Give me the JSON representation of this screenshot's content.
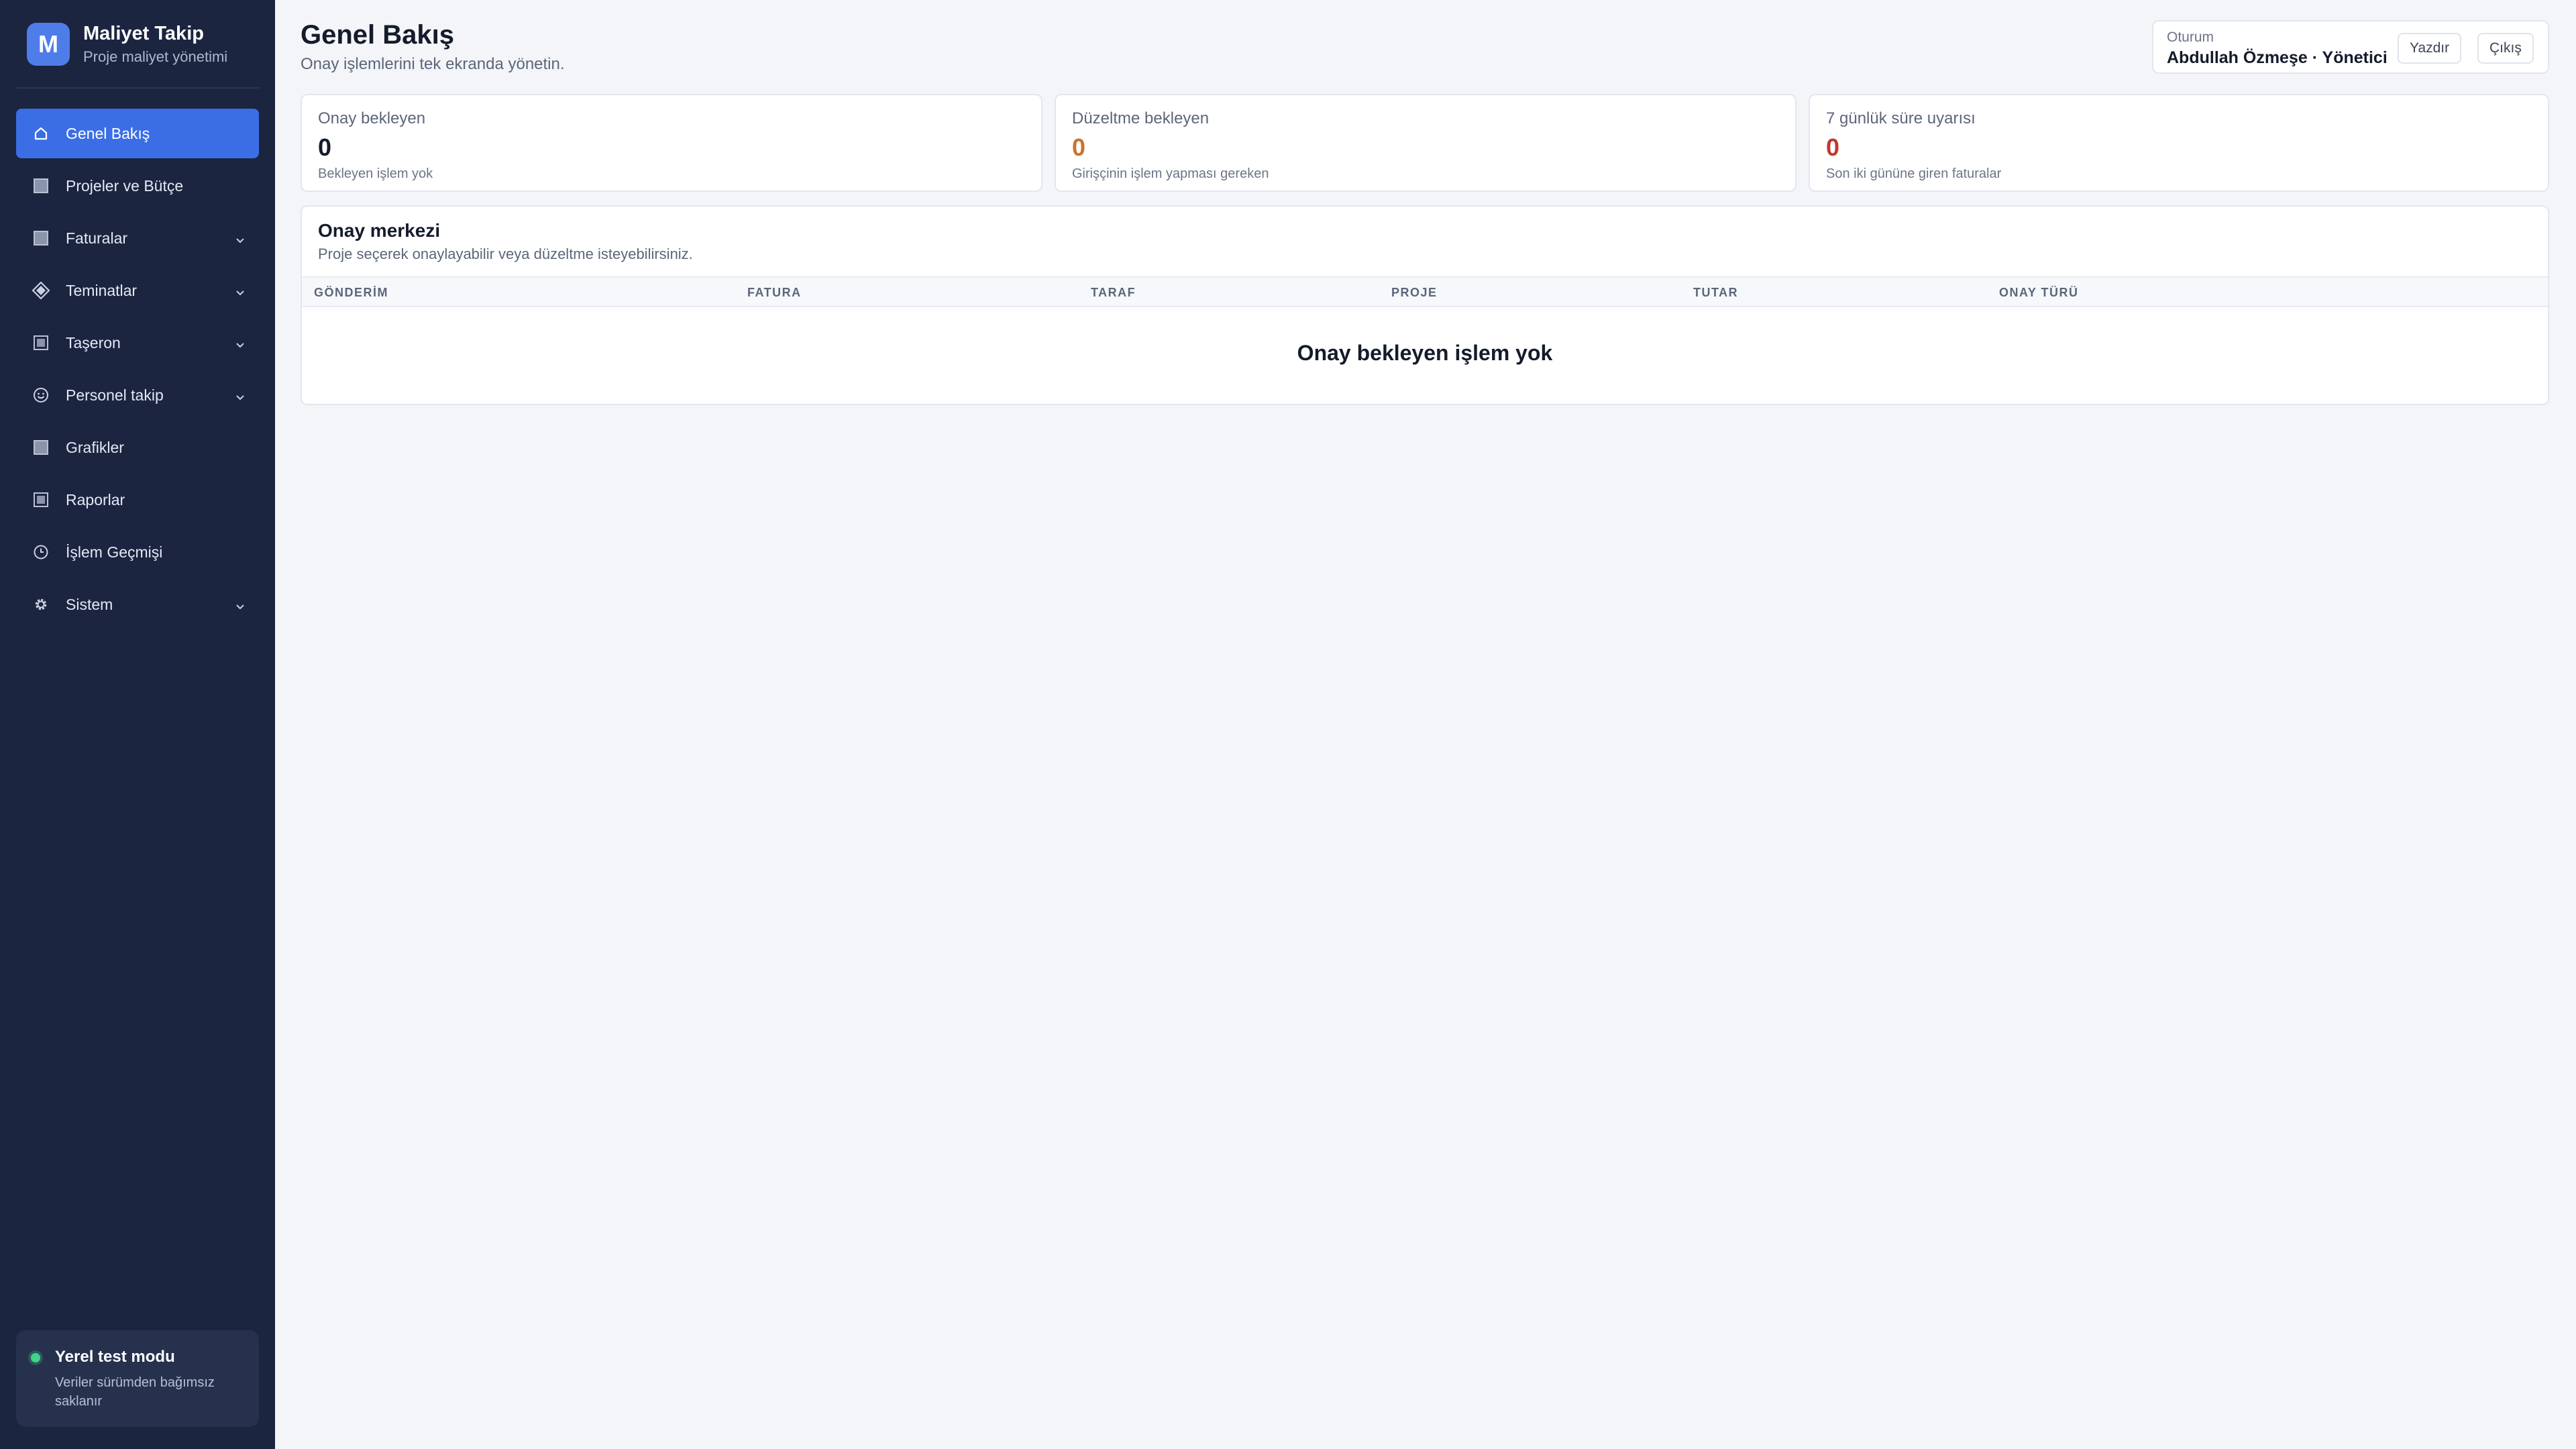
{
  "brand": {
    "logo_letter": "M",
    "title": "Maliyet Takip",
    "subtitle": "Proje maliyet yönetimi"
  },
  "sidebar": {
    "items": [
      {
        "label": "Genel Bakış",
        "icon": "home-icon",
        "active": true,
        "expandable": false
      },
      {
        "label": "Projeler ve Bütçe",
        "icon": "square-icon",
        "active": false,
        "expandable": false
      },
      {
        "label": "Faturalar",
        "icon": "square-icon",
        "active": false,
        "expandable": true
      },
      {
        "label": "Teminatlar",
        "icon": "diamond-icon",
        "active": false,
        "expandable": true
      },
      {
        "label": "Taşeron",
        "icon": "square-icon",
        "active": false,
        "expandable": true
      },
      {
        "label": "Personel takip",
        "icon": "smiley-icon",
        "active": false,
        "expandable": true
      },
      {
        "label": "Grafikler",
        "icon": "square-icon",
        "active": false,
        "expandable": false
      },
      {
        "label": "Raporlar",
        "icon": "square-icon",
        "active": false,
        "expandable": false
      },
      {
        "label": "İşlem Geçmişi",
        "icon": "clock-icon",
        "active": false,
        "expandable": false
      },
      {
        "label": "Sistem",
        "icon": "gear-icon",
        "active": false,
        "expandable": true
      }
    ],
    "test_mode": {
      "title": "Yerel test modu",
      "description": "Veriler sürümden bağımsız saklanır",
      "status_color": "#3fd48a"
    }
  },
  "header": {
    "title": "Genel Bakış",
    "subtitle": "Onay işlemlerini tek ekranda yönetin."
  },
  "session": {
    "label": "Oturum",
    "user": "Abdullah Özmeşe · Yönetici",
    "print_label": "Yazdır",
    "logout_label": "Çıkış"
  },
  "stats": [
    {
      "title": "Onay bekleyen",
      "value": "0",
      "note": "Bekleyen işlem yok",
      "color": "#141b2b"
    },
    {
      "title": "Düzeltme bekleyen",
      "value": "0",
      "note": "Girişçinin işlem yapması gereken",
      "color": "#c9742a"
    },
    {
      "title": "7 günlük süre uyarısı",
      "value": "0",
      "note": "Son iki gününe giren faturalar",
      "color": "#c0392b"
    }
  ],
  "approval_center": {
    "title": "Onay merkezi",
    "subtitle": "Proje seçerek onaylayabilir veya düzeltme isteyebilirsiniz.",
    "columns": [
      "GÖNDERİM",
      "FATURA",
      "TARAF",
      "PROJE",
      "TUTAR",
      "ONAY TÜRÜ"
    ],
    "empty_message": "Onay bekleyen işlem yok"
  },
  "colors": {
    "sidebar_bg": "#1b2540",
    "accent": "#3b6ee5",
    "page_bg": "#f3f5f9"
  }
}
